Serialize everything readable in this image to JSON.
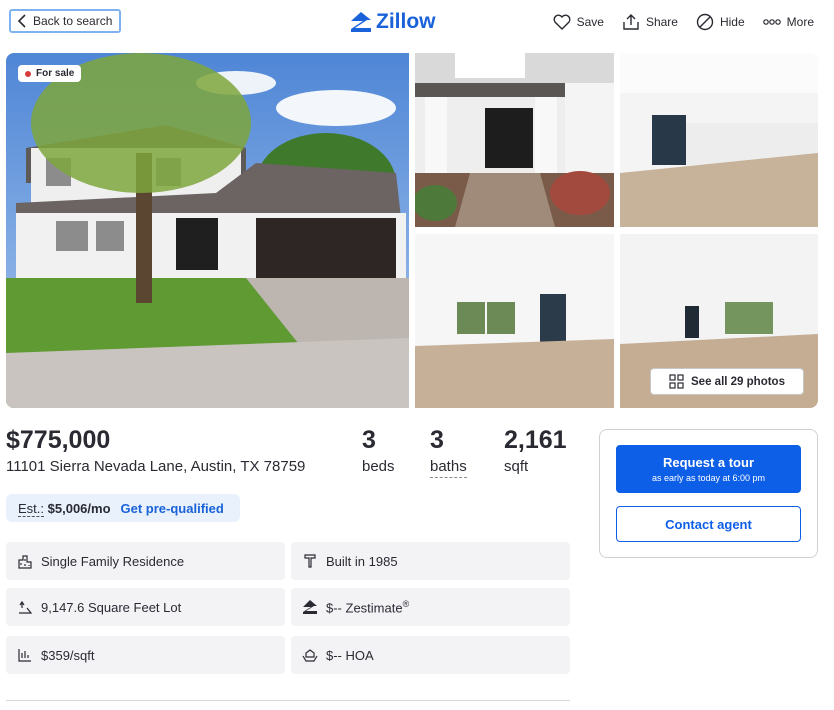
{
  "header": {
    "back_label": "Back to search",
    "logo_text": "Zillow",
    "actions": [
      {
        "label": "Save",
        "icon": "heart-icon"
      },
      {
        "label": "Share",
        "icon": "share-icon"
      },
      {
        "label": "Hide",
        "icon": "hide-icon"
      },
      {
        "label": "More",
        "icon": "more-icon"
      }
    ]
  },
  "gallery": {
    "badge": "For sale",
    "see_all": "See all 29 photos"
  },
  "listing": {
    "price": "$775,000",
    "address": "11101 Sierra Nevada Lane, Austin, TX 78759",
    "stats": [
      {
        "value": "3",
        "label": "beds"
      },
      {
        "value": "3",
        "label": "baths"
      },
      {
        "value": "2,161",
        "label": "sqft"
      }
    ],
    "estimate": {
      "prefix": "Est.:",
      "amount": "$5,006/mo",
      "cta": "Get pre-qualified"
    }
  },
  "facts": [
    {
      "text": "Single Family Residence",
      "icon": "building-icon"
    },
    {
      "text": "Built in 1985",
      "icon": "hammer-icon"
    },
    {
      "text": "9,147.6 Square Feet Lot",
      "icon": "lot-icon"
    },
    {
      "text": "$-- Zestimate",
      "sup": "®",
      "icon": "zestimate-icon"
    },
    {
      "text": "$359/sqft",
      "icon": "price-per-sqft-icon"
    },
    {
      "text": "$-- HOA",
      "icon": "hoa-icon"
    }
  ],
  "contact": {
    "request_title": "Request a tour",
    "request_sub": "as early as today at 6:00 pm",
    "contact_label": "Contact agent"
  },
  "colors": {
    "brand": "#1a62d9",
    "primary_button": "#0d5fe8",
    "badge_dot": "#d93b3b"
  }
}
